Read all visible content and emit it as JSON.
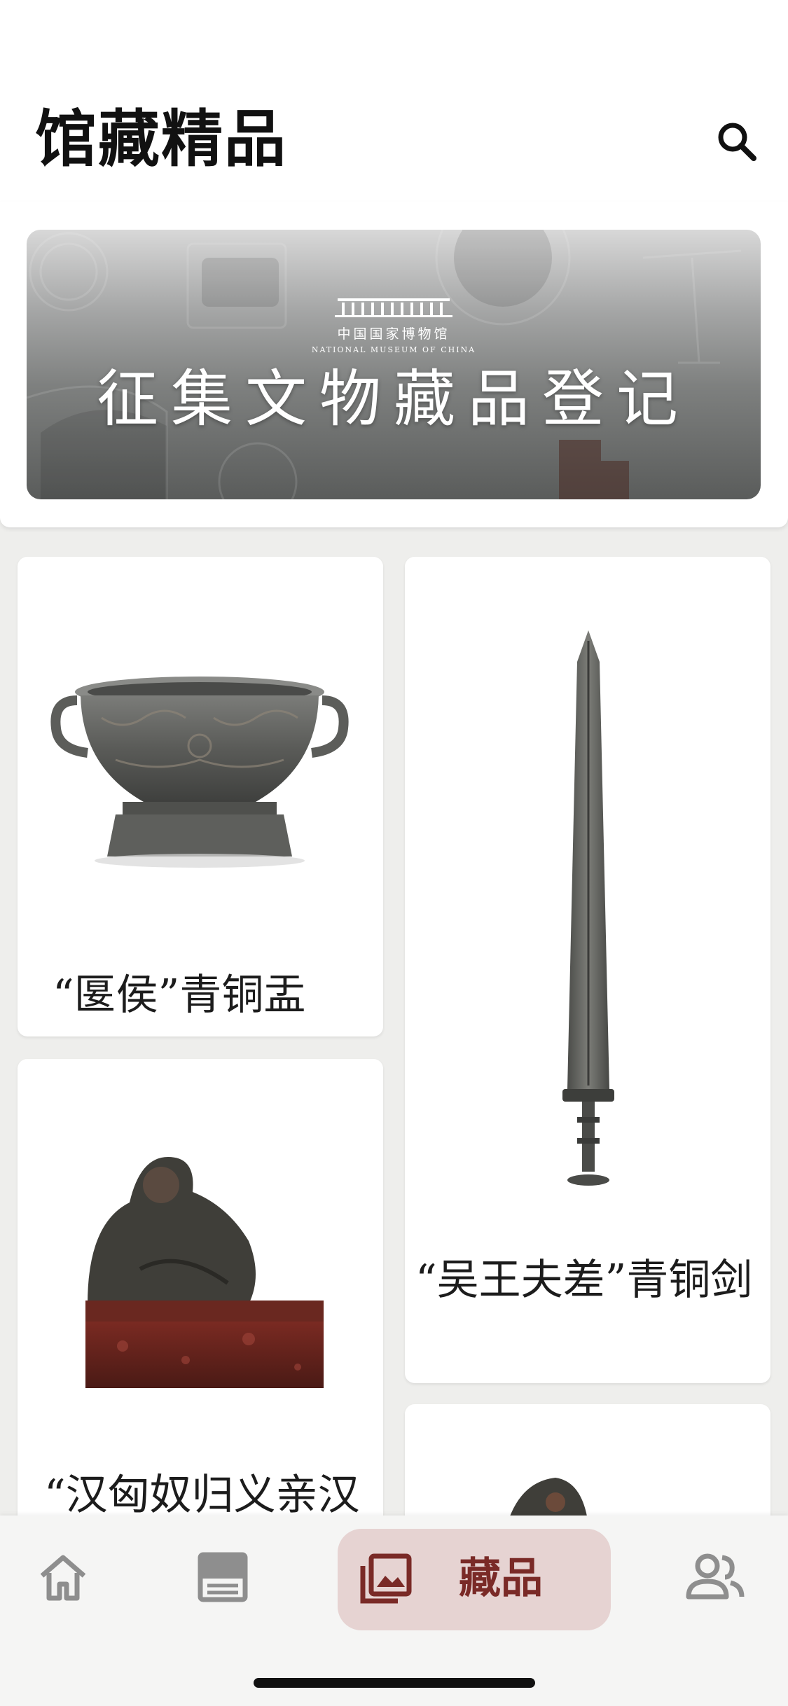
{
  "header": {
    "title": "馆藏精品",
    "search_icon": "search-icon"
  },
  "banner": {
    "logo_cn": "中国国家博物馆",
    "logo_en": "NATIONAL MUSEUM OF CHINA",
    "title": "征集文物藏品登记"
  },
  "collection": {
    "items": [
      {
        "caption": "“匽侯”青铜盂",
        "icon": "bronze-vessel-image"
      },
      {
        "caption": "“吴王夫差”青铜剑",
        "icon": "bronze-sword-image"
      },
      {
        "caption": "“汉匈奴归义亲汉",
        "icon": "seal-image"
      },
      {
        "caption": "",
        "icon": "artifact-image"
      }
    ]
  },
  "bottom_nav": {
    "items": [
      {
        "icon": "home-icon",
        "label": ""
      },
      {
        "icon": "book-icon",
        "label": ""
      },
      {
        "icon": "photo-library-icon",
        "label": "藏品",
        "active": true
      },
      {
        "icon": "people-icon",
        "label": ""
      }
    ]
  },
  "colors": {
    "accent": "#7a2a27",
    "active_pill": "#e6d3d2",
    "background": "#eeeeec"
  }
}
